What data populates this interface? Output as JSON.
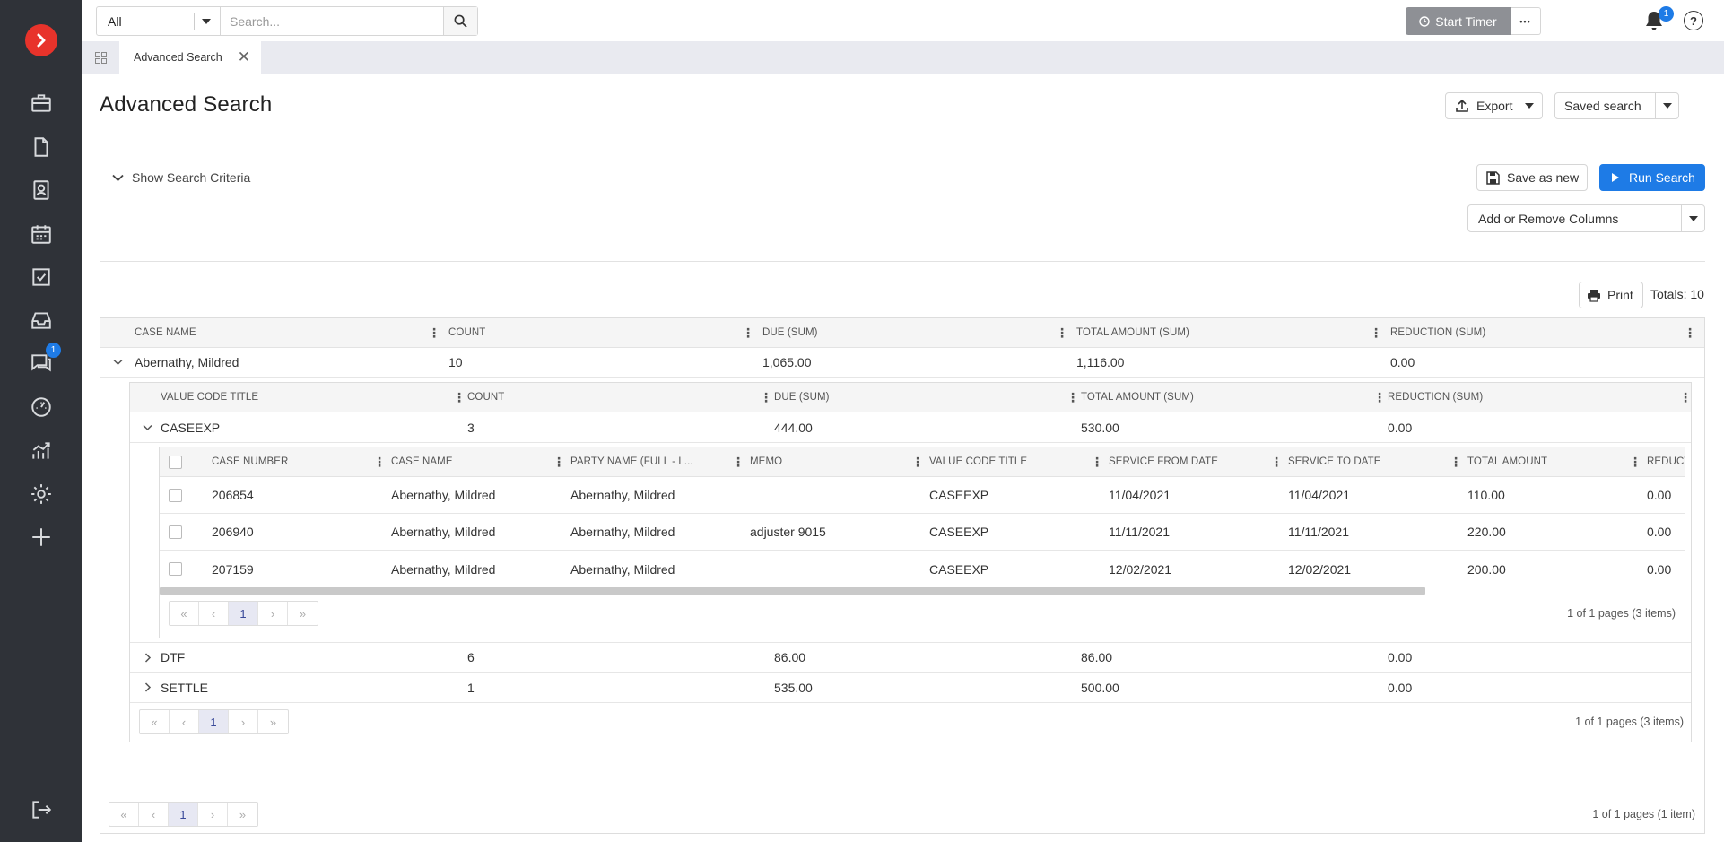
{
  "topbar": {
    "scope": "All",
    "search_placeholder": "Search...",
    "start_timer": "Start Timer",
    "more": "•••",
    "notification_count": "1",
    "help": "?"
  },
  "sidebar": {
    "chat_badge": "1"
  },
  "tabs": [
    {
      "label": "Advanced Search"
    }
  ],
  "page": {
    "title": "Advanced Search",
    "export_label": "Export",
    "saved_search_label": "Saved search",
    "show_criteria": "Show Search Criteria",
    "save_as_new": "Save as new",
    "run_search": "Run Search",
    "add_remove_columns": "Add or Remove Columns",
    "print_label": "Print",
    "totals": "Totals: 10"
  },
  "outer": {
    "columns": [
      "CASE NAME",
      "COUNT",
      "DUE (SUM)",
      "TOTAL AMOUNT (SUM)",
      "REDUCTION (SUM)"
    ],
    "row": {
      "name": "Abernathy, Mildred",
      "count": "10",
      "due": "1,065.00",
      "total": "1,116.00",
      "reduction": "0.00"
    },
    "pager": {
      "page": "1",
      "info": "1 of 1 pages (1 item)"
    }
  },
  "mid": {
    "columns": [
      "VALUE CODE TITLE",
      "COUNT",
      "DUE (SUM)",
      "TOTAL AMOUNT (SUM)",
      "REDUCTION (SUM)"
    ],
    "rows": [
      {
        "name": "CASEEXP",
        "count": "3",
        "due": "444.00",
        "total": "530.00",
        "reduction": "0.00"
      },
      {
        "name": "DTF",
        "count": "6",
        "due": "86.00",
        "total": "86.00",
        "reduction": "0.00"
      },
      {
        "name": "SETTLE",
        "count": "1",
        "due": "535.00",
        "total": "500.00",
        "reduction": "0.00"
      }
    ],
    "pager": {
      "page": "1",
      "info": "1 of 1 pages (3 items)"
    }
  },
  "inner": {
    "columns": [
      "CASE NUMBER",
      "CASE NAME",
      "PARTY NAME (FULL - L...",
      "MEMO",
      "VALUE CODE TITLE",
      "SERVICE FROM DATE",
      "SERVICE TO DATE",
      "TOTAL AMOUNT",
      "REDUCT"
    ],
    "rows": [
      [
        "206854",
        "Abernathy, Mildred",
        "Abernathy, Mildred",
        "",
        "CASEEXP",
        "11/04/2021",
        "11/04/2021",
        "110.00",
        "0.00"
      ],
      [
        "206940",
        "Abernathy, Mildred",
        "Abernathy, Mildred",
        "adjuster 9015",
        "CASEEXP",
        "11/11/2021",
        "11/11/2021",
        "220.00",
        "0.00"
      ],
      [
        "207159",
        "Abernathy, Mildred",
        "Abernathy, Mildred",
        "",
        "CASEEXP",
        "12/02/2021",
        "12/02/2021",
        "200.00",
        "0.00"
      ]
    ],
    "pager": {
      "page": "1",
      "info": "1 of 1 pages (3 items)"
    }
  },
  "pager_icons": {
    "first": "«",
    "prev": "‹",
    "next": "›",
    "last": "»"
  }
}
